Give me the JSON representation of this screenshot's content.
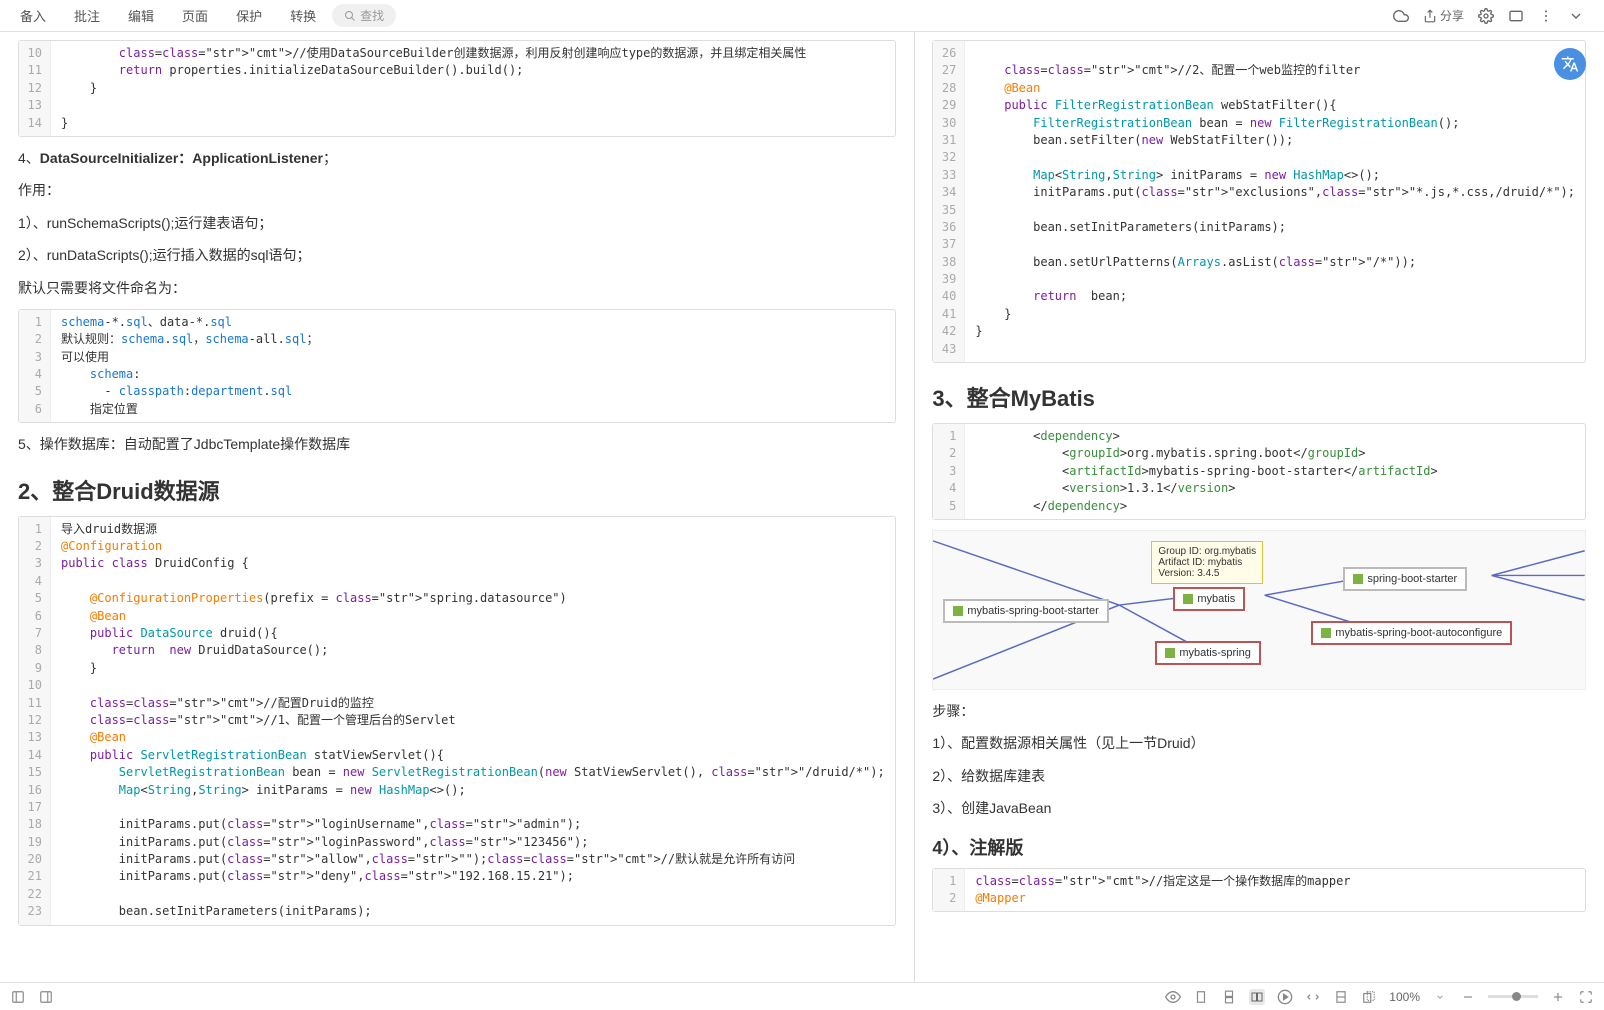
{
  "topbar": {
    "menus": [
      "备入",
      "批注",
      "编辑",
      "页面",
      "保护",
      "转换"
    ],
    "search_label": "查找",
    "share_label": "分享"
  },
  "left_page": {
    "code1_start": 10,
    "code1_lines": [
      "        //使用DataSourceBuilder创建数据源，利用反射创建响应type的数据源，并且绑定相关属性",
      "        return properties.initializeDataSourceBuilder().build();",
      "    }",
      "",
      "}"
    ],
    "p4_prefix": "4、",
    "p4_strong": "DataSourceInitializer：ApplicationListener",
    "p4_suffix": "；",
    "p_role": "作用：",
    "p_1": "1）、runSchemaScripts();运行建表语句；",
    "p_2": "2）、runDataScripts();运行插入数据的sql语句；",
    "p_default": "默认只需要将文件命名为：",
    "code2_lines": [
      "schema-*.sql、data-*.sql",
      "默认规则：schema.sql，schema-all.sql；",
      "可以使用",
      "    schema:",
      "      - classpath:department.sql",
      "    指定位置"
    ],
    "p5": "5、操作数据库：自动配置了JdbcTemplate操作数据库",
    "h2": "2、整合Druid数据源",
    "code3_lines": [
      "导入druid数据源",
      "@Configuration",
      "public class DruidConfig {",
      "",
      "    @ConfigurationProperties(prefix = \"spring.datasource\")",
      "    @Bean",
      "    public DataSource druid(){",
      "       return  new DruidDataSource();",
      "    }",
      "",
      "    //配置Druid的监控",
      "    //1、配置一个管理后台的Servlet",
      "    @Bean",
      "    public ServletRegistrationBean statViewServlet(){",
      "        ServletRegistrationBean bean = new ServletRegistrationBean(new StatViewServlet(), \"/druid/*\");",
      "        Map<String,String> initParams = new HashMap<>();",
      "",
      "        initParams.put(\"loginUsername\",\"admin\");",
      "        initParams.put(\"loginPassword\",\"123456\");",
      "        initParams.put(\"allow\",\"\");//默认就是允许所有访问",
      "        initParams.put(\"deny\",\"192.168.15.21\");",
      "",
      "        bean.setInitParameters(initParams);"
    ]
  },
  "right_page": {
    "code1_start": 26,
    "code1_lines": [
      "",
      "    //2、配置一个web监控的filter",
      "    @Bean",
      "    public FilterRegistrationBean webStatFilter(){",
      "        FilterRegistrationBean bean = new FilterRegistrationBean();",
      "        bean.setFilter(new WebStatFilter());",
      "",
      "        Map<String,String> initParams = new HashMap<>();",
      "        initParams.put(\"exclusions\",\"*.js,*.css,/druid/*\");",
      "",
      "        bean.setInitParameters(initParams);",
      "",
      "        bean.setUrlPatterns(Arrays.asList(\"/*\"));",
      "",
      "        return  bean;",
      "    }",
      "}",
      ""
    ],
    "h2": "3、整合MyBatis",
    "dep_lines": [
      "        <dependency>",
      "            <groupId>org.mybatis.spring.boot</groupId>",
      "            <artifactId>mybatis-spring-boot-starter</artifactId>",
      "            <version>1.3.1</version>",
      "        </dependency>"
    ],
    "diagram": {
      "tip_l1": "Group ID: org.mybatis",
      "tip_l2": "Artifact ID: mybatis",
      "tip_l3": "Version: 3.4.5",
      "n1": "mybatis-spring-boot-starter",
      "n2": "mybatis",
      "n3": "mybatis-spring",
      "n4": "spring-boot-starter",
      "n5": "mybatis-spring-boot-autoconfigure"
    },
    "p_steps": "步骤：",
    "p_s1": "1）、配置数据源相关属性（见上一节Druid）",
    "p_s2": "2）、给数据库建表",
    "p_s3": "3）、创建JavaBean",
    "h3": "4）、注解版",
    "code3_lines": [
      "//指定这是一个操作数据库的mapper",
      "@Mapper"
    ]
  },
  "bottom": {
    "zoom": "100%"
  }
}
